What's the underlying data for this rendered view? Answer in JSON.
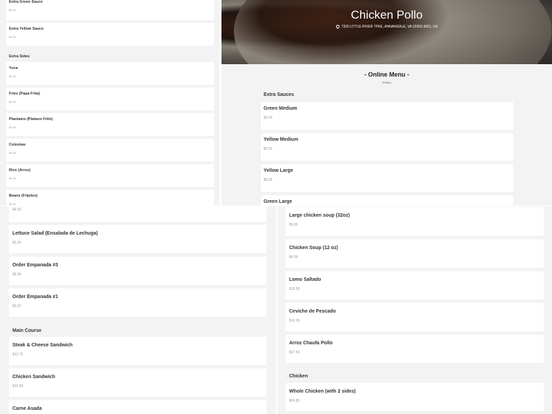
{
  "top_left": {
    "items_a": [
      {
        "name": "Extra Green Sauce",
        "price": "$0.50"
      },
      {
        "name": "Extra Yellow Sauce",
        "price": "$0.50"
      }
    ],
    "section": "Extra Sides",
    "items_b": [
      {
        "name": "Yuca",
        "price": "$4.50"
      },
      {
        "name": "Fries (Papa Frita)",
        "price": "$4.50"
      },
      {
        "name": "Plantains (Platano Frito)",
        "price": "$4.50"
      },
      {
        "name": "Coleslaw",
        "price": "$4.50"
      },
      {
        "name": "Rice (Arroz)",
        "price": "$4.50"
      },
      {
        "name": "Beans (Frijoles)",
        "price": "$4.50"
      }
    ]
  },
  "top_right": {
    "restaurant_name": "Chicken Pollo",
    "address": "7320 LITTLE RIVER TPKE, ANNANDALE, VA 22003-3001, US",
    "menu_title": "- Online Menu -",
    "item_count": "49 items",
    "section": "Extra Sauces",
    "items": [
      {
        "name": "Green Medium",
        "price": "$3.00"
      },
      {
        "name": "Yellow Medium",
        "price": "$2.50"
      },
      {
        "name": "Yellow Large",
        "price": "$5.99"
      },
      {
        "name": "Green Large",
        "price": ""
      }
    ]
  },
  "bottom_left": {
    "partial_price": "$4.50",
    "items_a": [
      {
        "name": "Lettuce Salad (Ensalada de Lechuga)",
        "price": "$2.99"
      },
      {
        "name": "Order Empanada #3",
        "price": "$8.99"
      },
      {
        "name": "Order Empanada #1",
        "price": "$3.50"
      }
    ],
    "section": "Main Course",
    "items_b": [
      {
        "name": "Steak & Cheese Sandwich",
        "price": "$12.75"
      },
      {
        "name": "Chicken Sandwich",
        "price": "$10.99"
      },
      {
        "name": "Carne Asada",
        "price": ""
      }
    ]
  },
  "bottom_right": {
    "items_a": [
      {
        "name": "Large chicken soup (32oz)",
        "price": "$9.85"
      },
      {
        "name": "Chicken Soup (12 oz)",
        "price": "$4.99"
      },
      {
        "name": "Lomo Saltado",
        "price": "$19.95"
      },
      {
        "name": "Ceviche de Pescado",
        "price": "$16.99"
      },
      {
        "name": "Arroz Chaufa Pollo",
        "price": "$17.50"
      }
    ],
    "section": "Chicken",
    "items_b": [
      {
        "name": "Whole Chicken (with 2 sides)",
        "price": "$24.85"
      }
    ]
  }
}
